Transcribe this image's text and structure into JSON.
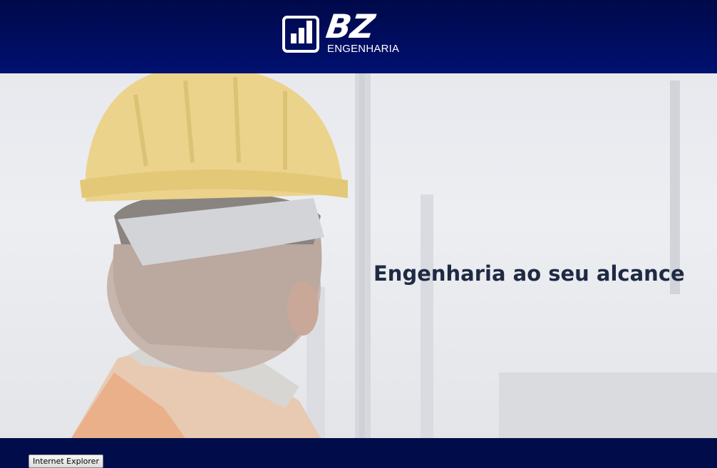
{
  "header": {
    "logo": {
      "icon": "bar-chart-box-icon",
      "brand_mark": "BZ",
      "brand_sub": "ENGENHARIA"
    },
    "background_color": "#000a5c"
  },
  "hero": {
    "title": "Engenharia ao seu alcance",
    "image": "worker-with-hard-hat-photo",
    "title_color": "#1f2a44"
  },
  "footer": {
    "button_label": "Internet Explorer",
    "background_color": "#000d4a"
  }
}
